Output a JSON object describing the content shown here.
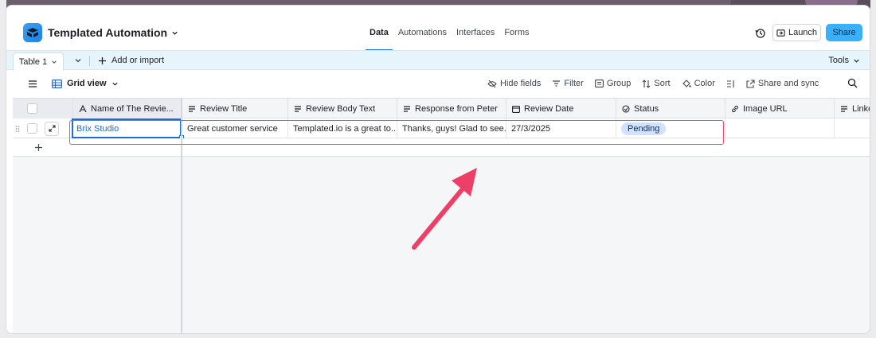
{
  "header": {
    "base_name": "Templated Automation",
    "nav": [
      "Data",
      "Automations",
      "Interfaces",
      "Forms"
    ],
    "active_nav": "Data",
    "launch_label": "Launch",
    "share_label": "Share"
  },
  "tablebar": {
    "table_name": "Table 1",
    "add_import_label": "Add or import",
    "tools_label": "Tools"
  },
  "viewbar": {
    "view_name": "Grid view",
    "actions": [
      "Hide fields",
      "Filter",
      "Group",
      "Sort",
      "Color",
      "Share and sync"
    ]
  },
  "grid": {
    "columns": [
      {
        "label": "Name of The Revie...",
        "icon": "text-a-icon"
      },
      {
        "label": "Review Title",
        "icon": "long-text-icon"
      },
      {
        "label": "Review Body Text",
        "icon": "long-text-icon"
      },
      {
        "label": "Response from Peter",
        "icon": "long-text-icon"
      },
      {
        "label": "Review Date",
        "icon": "calendar-icon"
      },
      {
        "label": "Status",
        "icon": "status-circle-icon"
      },
      {
        "label": "Image URL",
        "icon": "link-icon"
      },
      {
        "label": "LinkedI",
        "icon": "long-text-icon"
      }
    ],
    "rows": [
      {
        "name": "Brix Studio",
        "review_title": "Great customer service",
        "review_body": "Templated.io is a great to...",
        "response": "Thanks, guys! Glad to see...",
        "review_date": "27/3/2025",
        "status": "Pending",
        "image_url": "",
        "linkedin": ""
      }
    ]
  },
  "colors": {
    "accent": "#166ee1",
    "share_button": "#3ab0fb",
    "status_pill": "#d1e2ff",
    "annotation": "#e8506e"
  }
}
